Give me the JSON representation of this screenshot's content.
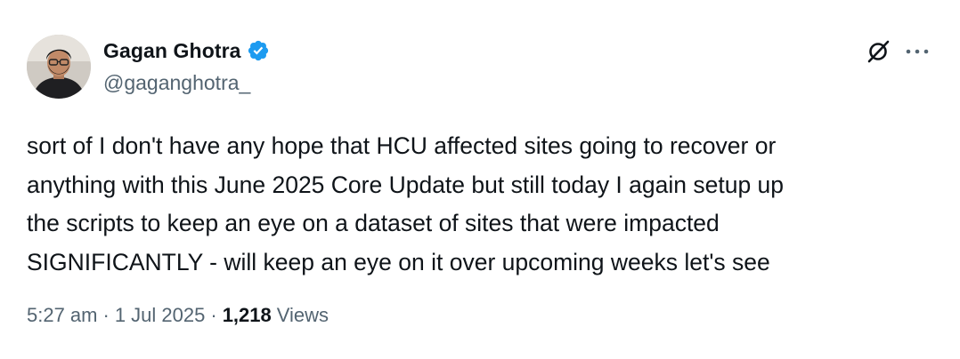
{
  "author": {
    "display_name": "Gagan Ghotra",
    "handle": "@gaganghotra_",
    "verified": true,
    "verified_color": "#1d9bf0"
  },
  "actions": {
    "grok_icon": "grok-icon",
    "more_icon": "more-icon"
  },
  "tweet": {
    "text": "sort of I don't have any hope that HCU affected sites going to recover or\nanything with this June 2025 Core Update but still today I again setup up\nthe scripts to keep an eye on a dataset of sites that were impacted\nSIGNIFICANTLY - will keep an eye on it over upcoming weeks let's see"
  },
  "meta": {
    "time": "5:27 am",
    "separator": "·",
    "date": "1 Jul 2025",
    "views_count": "1,218",
    "views_label": "Views"
  }
}
